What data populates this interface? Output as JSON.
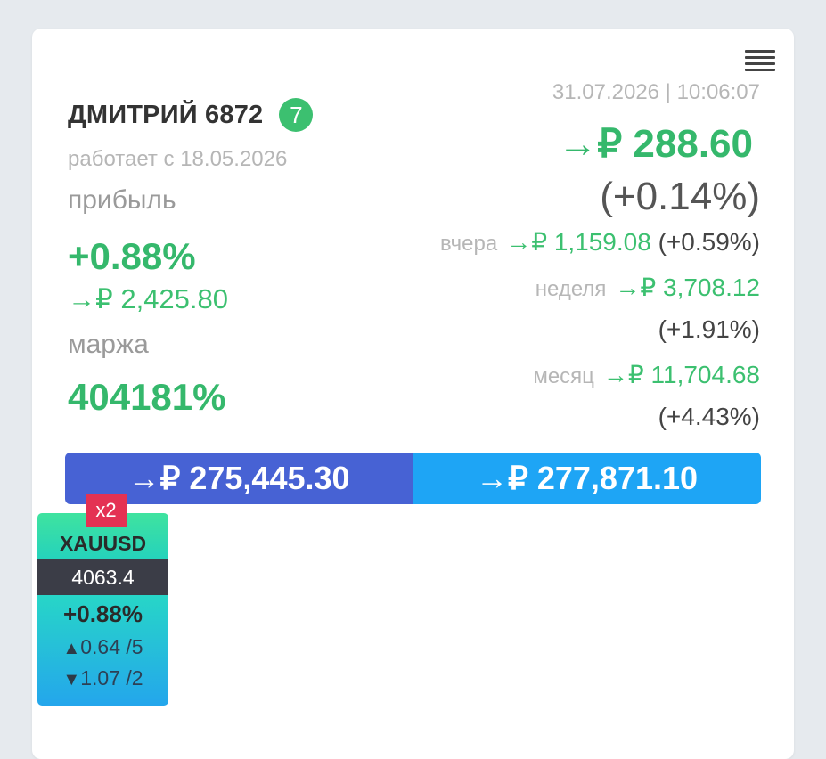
{
  "account": {
    "name": "ДМИТРИЙ 6872",
    "badge_count": "7",
    "since": "работает с 18.05.2026",
    "profit_label": "прибыль",
    "profit_percent": "+0.88%",
    "profit_amount": "→₽ 2,425.80",
    "margin_label": "маржа",
    "margin_value": "404181%"
  },
  "stats": {
    "datetime": "31.07.2026 | 10:06:07",
    "daily_amount": "→₽ 288.60",
    "daily_percent": "(+0.14%)",
    "yesterday_label": "вчера",
    "yesterday_amount": "→₽ 1,159.08",
    "yesterday_percent": "(+0.59%)",
    "week_label": "неделя",
    "week_amount": "→₽ 3,708.12",
    "week_percent": "(+1.91%)",
    "month_label": "месяц",
    "month_amount": "→₽ 11,704.68",
    "month_percent": "(+4.43%)"
  },
  "balance": {
    "left": "→₽ 275,445.30",
    "right": "→₽ 277,871.10"
  },
  "ticker": {
    "multiplier": "x2",
    "symbol": "XAUUSD",
    "price": "4063.4",
    "change": "+0.88%",
    "up_icon": "▲",
    "up": "0.64 /5",
    "down_icon": "▼",
    "down": "1.07 /2"
  },
  "colors": {
    "green": "#35b86c",
    "bar_left": "#4762d4",
    "bar_right": "#1ea5f5",
    "multiplier": "#e43253"
  },
  "icons": {
    "menu": "hamburger-menu-icon"
  }
}
